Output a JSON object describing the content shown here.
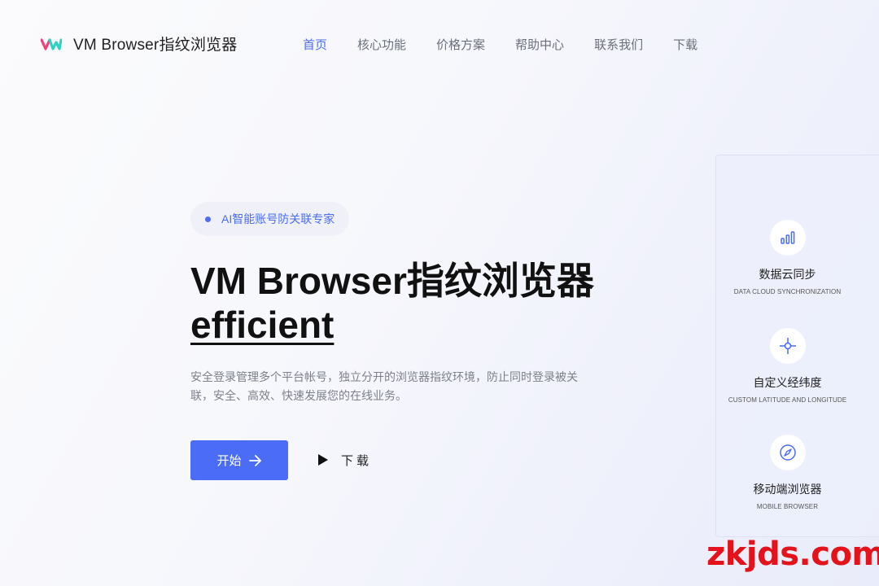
{
  "header": {
    "brand": "VM Browser指纹浏览器",
    "nav": [
      {
        "label": "首页",
        "active": true
      },
      {
        "label": "核心功能",
        "active": false
      },
      {
        "label": "价格方案",
        "active": false
      },
      {
        "label": "帮助中心",
        "active": false
      },
      {
        "label": "联系我们",
        "active": false
      },
      {
        "label": "下载",
        "active": false
      }
    ]
  },
  "hero": {
    "badge": "AI智能账号防关联专家",
    "title_main": "VM Browser指纹浏览器",
    "title_emphasis": "efficient",
    "description": "安全登录管理多个平台帐号，独立分开的浏览器指纹环境，防止同时登录被关联，安全、高效、快速发展您的在线业务。",
    "start_label": "开始",
    "download_label": "下载"
  },
  "features": [
    {
      "icon": "bar-chart-icon",
      "title": "数据云同步",
      "subtitle": "DATA CLOUD SYNCHRONIZATION"
    },
    {
      "icon": "crosshair-icon",
      "title": "自定义经纬度",
      "subtitle": "CUSTOM LATITUDE AND LONGITUDE"
    },
    {
      "icon": "compass-icon",
      "title": "移动端浏览器",
      "subtitle": "MOBILE BROWSER"
    }
  ],
  "watermark": "zkjds.com",
  "colors": {
    "accent": "#4a6cf7",
    "watermark": "#e3121b"
  }
}
